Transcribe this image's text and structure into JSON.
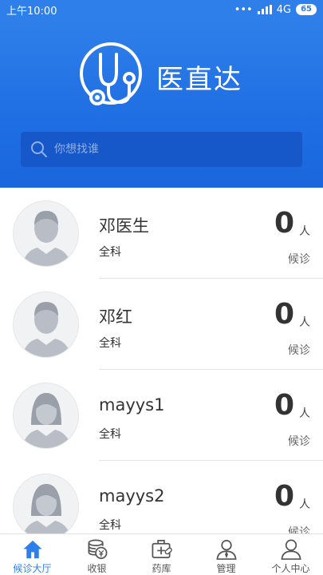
{
  "status_bar": {
    "time": "上午10:00",
    "network": "4G",
    "battery": "65"
  },
  "header": {
    "brand": "医直达",
    "logo_icon": "stethoscope-icon"
  },
  "search": {
    "placeholder": "你想找谁"
  },
  "doctors": [
    {
      "name": "邓医生",
      "dept": "全科",
      "count": "0",
      "unit": "人",
      "wait_label": "候诊",
      "avatar": "male-avatar-icon"
    },
    {
      "name": "邓红",
      "dept": "全科",
      "count": "0",
      "unit": "人",
      "wait_label": "候诊",
      "avatar": "male-avatar-icon"
    },
    {
      "name": "mayys1",
      "dept": "全科",
      "count": "0",
      "unit": "人",
      "wait_label": "候诊",
      "avatar": "female-avatar-icon"
    },
    {
      "name": "mayys2",
      "dept": "全科",
      "count": "0",
      "unit": "人",
      "wait_label": "候诊",
      "avatar": "female-avatar-icon"
    }
  ],
  "tabs": [
    {
      "label": "候诊大厅",
      "icon": "home-icon",
      "active": true
    },
    {
      "label": "收银",
      "icon": "coins-icon",
      "active": false
    },
    {
      "label": "药库",
      "icon": "medicine-box-icon",
      "active": false
    },
    {
      "label": "管理",
      "icon": "manager-icon",
      "active": false
    },
    {
      "label": "个人中心",
      "icon": "person-icon",
      "active": false
    }
  ],
  "colors": {
    "primary": "#2f7fea",
    "search_bg": "#1657c9",
    "text": "#333333"
  }
}
